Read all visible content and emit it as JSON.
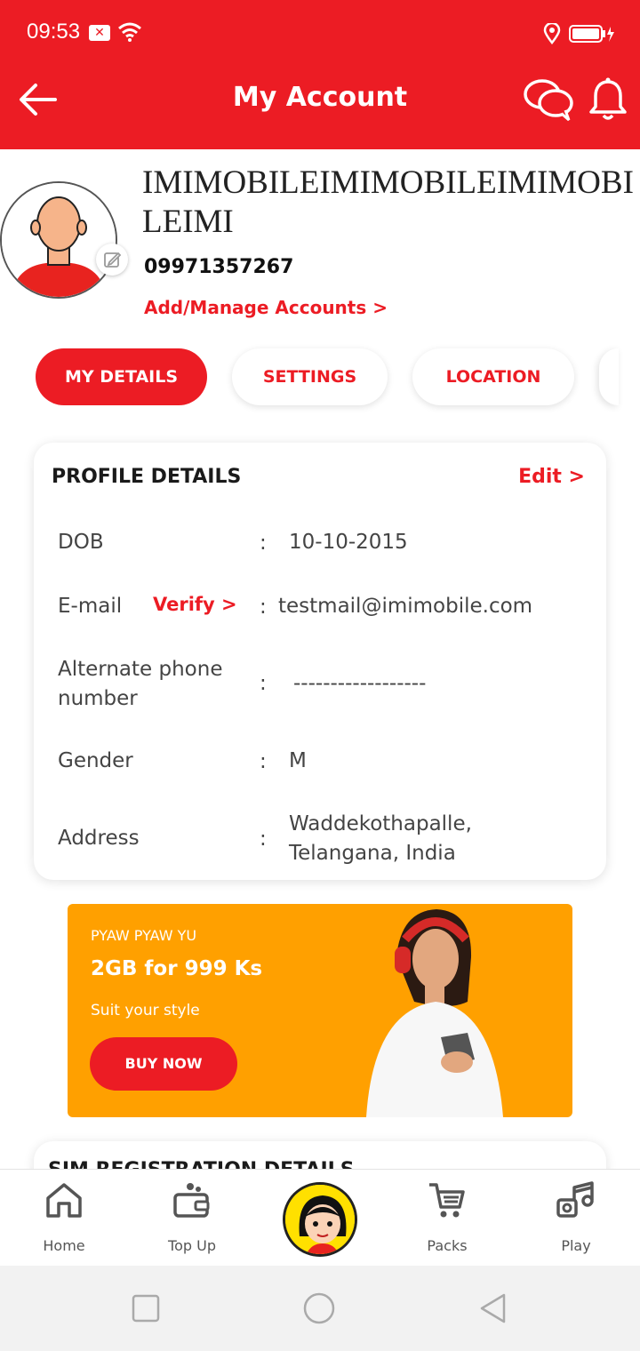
{
  "status_bar": {
    "time": "09:53"
  },
  "header": {
    "title": "My Account"
  },
  "profile": {
    "name": "IMIMOBILEIMIMOBILEIMIMOBILEIMI",
    "phone": "09971357267",
    "manage_link": "Add/Manage Accounts >"
  },
  "tabs": [
    {
      "label": "MY DETAILS",
      "active": true
    },
    {
      "label": "SETTINGS",
      "active": false
    },
    {
      "label": "LOCATION",
      "active": false
    }
  ],
  "profile_details": {
    "title": "PROFILE DETAILS",
    "edit_label": "Edit >",
    "verify_label": "Verify >",
    "colon": ":",
    "rows": [
      {
        "label": "DOB",
        "value": "10-10-2015"
      },
      {
        "label": "E-mail",
        "value": "testmail@imimobile.com"
      },
      {
        "label": "Alternate phone number",
        "value": "------------------"
      },
      {
        "label": "Gender",
        "value": "M"
      },
      {
        "label": "Address",
        "value": "Waddekothapalle, Telangana, India"
      }
    ]
  },
  "banner": {
    "eyebrow": "PYAW PYAW YU",
    "headline": "2GB for 999 Ks",
    "subtitle": "Suit your style",
    "cta": "BUY NOW"
  },
  "next_section": {
    "title": "SIM REGISTRATION DETAILS"
  },
  "bottom_nav": [
    {
      "label": "Home",
      "icon": "home-icon"
    },
    {
      "label": "Top Up",
      "icon": "wallet-icon"
    },
    {
      "label": "",
      "icon": "mascot-avatar"
    },
    {
      "label": "Packs",
      "icon": "cart-icon"
    },
    {
      "label": "Play",
      "icon": "music-icon"
    }
  ],
  "colors": {
    "brand": "#ec1c24",
    "banner": "#ffa000",
    "text": "#444444"
  }
}
